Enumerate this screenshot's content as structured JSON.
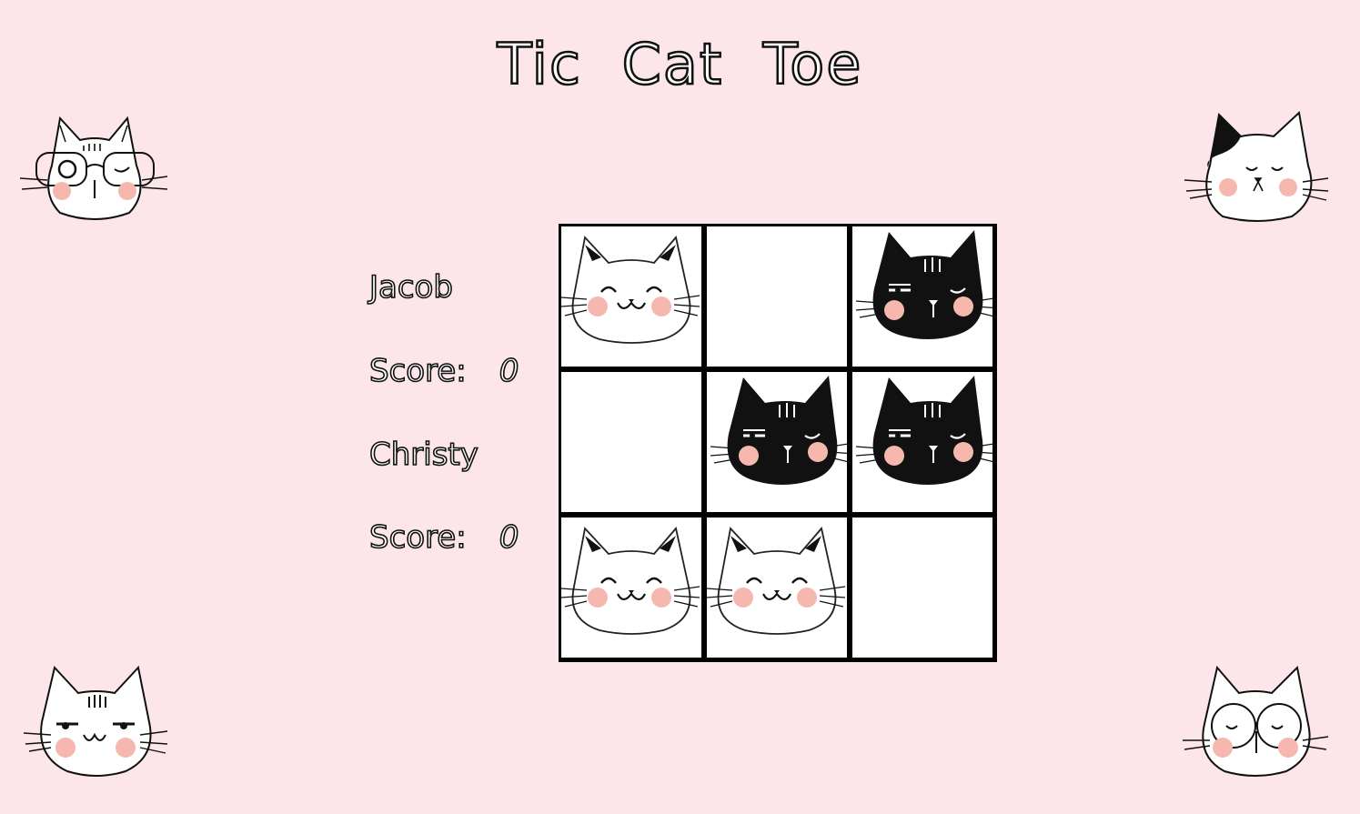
{
  "title": "Tic Cat Toe",
  "players": [
    {
      "name": "Jacob",
      "score_label": "Score:",
      "score": "0"
    },
    {
      "name": "Christy",
      "score_label": "Score:",
      "score": "0"
    }
  ],
  "board": [
    [
      "white-cat",
      "",
      "black-cat"
    ],
    [
      "",
      "black-cat",
      "black-cat"
    ],
    [
      "white-cat",
      "white-cat",
      ""
    ]
  ],
  "decorations": [
    "cat-with-glasses-icon",
    "patched-cat-icon",
    "striped-cat-icon",
    "cat-with-round-glasses-icon"
  ],
  "colors": {
    "background": "#fde6ea",
    "blush": "#f6b8ae",
    "grid": "#000000"
  }
}
